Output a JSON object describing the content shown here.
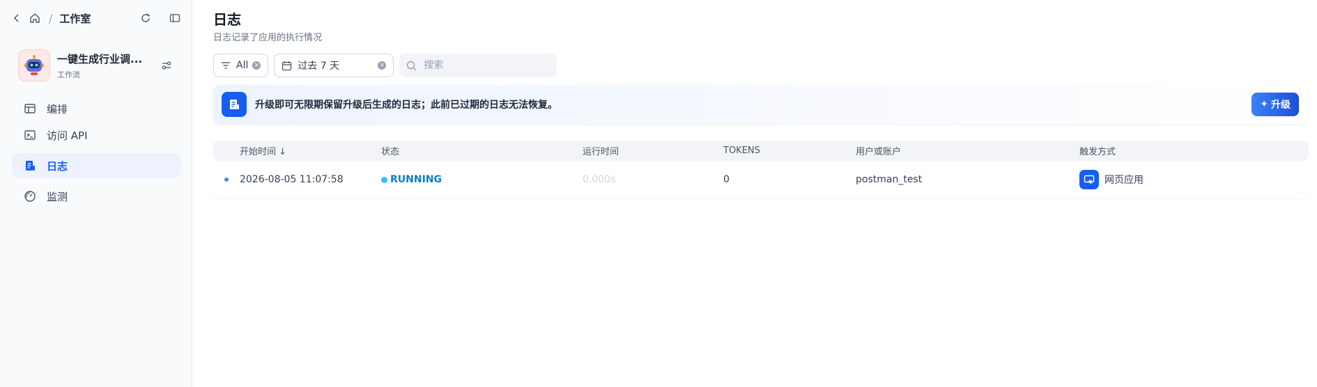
{
  "breadcrumb": {
    "title": "工作室"
  },
  "app": {
    "name": "一键生成行业调...",
    "type": "工作流"
  },
  "nav": [
    {
      "label": "编排",
      "icon": "layout-icon"
    },
    {
      "label": "访问 API",
      "icon": "terminal-icon"
    },
    {
      "label": "日志",
      "icon": "document-icon",
      "active": true
    },
    {
      "label": "监测",
      "icon": "gauge-icon"
    }
  ],
  "page": {
    "title": "日志",
    "subtitle": "日志记录了应用的执行情况"
  },
  "filters": {
    "status": "All",
    "period": "过去 7 天",
    "search_placeholder": "搜索"
  },
  "banner": {
    "text": "升级即可无限期保留升级后生成的日志；此前已过期的日志无法恢复。",
    "button": "升级"
  },
  "table": {
    "headers": [
      "开始时间 ↓",
      "状态",
      "运行时间",
      "TOKENS",
      "用户或账户",
      "触发方式"
    ],
    "rows": [
      {
        "start": "2026-08-05 11:07:58",
        "status": "RUNNING",
        "runtime": "0.000s",
        "tokens": "0",
        "user": "postman_test",
        "trigger": "网页应用"
      }
    ]
  },
  "colors": {
    "accent": "#155eef",
    "running": "#36bffa"
  }
}
